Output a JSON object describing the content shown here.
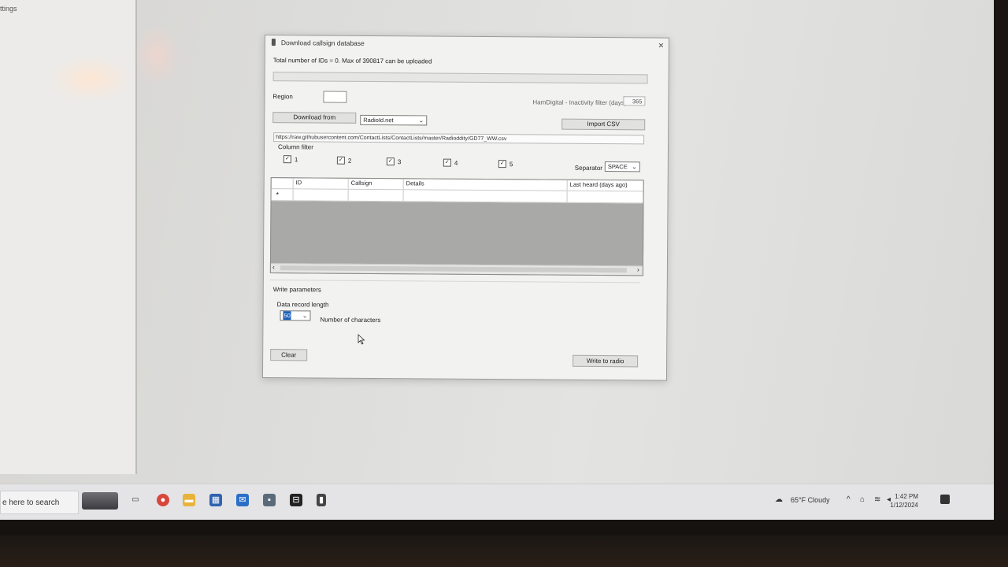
{
  "background_window": {
    "partial_text": "ttings"
  },
  "dialog": {
    "title": "Download callsign database",
    "close_glyph": "×",
    "total_text": "Total number of IDs = 0. Max of 390817 can be uploaded",
    "progress_fraction": 0,
    "region_label": "Region",
    "region_value": "",
    "inactivity_label": "HamDigital - Inactivity filter (days)",
    "inactivity_value": "365",
    "download_from_label": "Download from",
    "source_selected": "RadioId.net",
    "import_csv_label": "Import CSV",
    "url": "https://raw.githubusercontent.com/ContactLists/ContactLists/master/Radioddity/GD77_WW.csv",
    "column_filter_label": "Column filter",
    "column_checkboxes": [
      {
        "label": "1",
        "checked": true
      },
      {
        "label": "2",
        "checked": true
      },
      {
        "label": "3",
        "checked": true
      },
      {
        "label": "4",
        "checked": true
      },
      {
        "label": "5",
        "checked": true
      }
    ],
    "separator_label": "Separator",
    "separator_value": "SPACE",
    "grid": {
      "columns": [
        "ID",
        "Callsign",
        "Details",
        "Last heard (days ago)"
      ],
      "new_row_marker": "*"
    },
    "write_parameters_label": "Write parameters",
    "data_record_length_label": "Data record length",
    "data_record_length_value": "50",
    "number_of_characters_label": "Number of characters",
    "clear_label": "Clear",
    "write_to_radio_label": "Write to radio"
  },
  "taskbar": {
    "search_placeholder": "e here to search",
    "weather": "65°F  Cloudy",
    "time": "1:42 PM",
    "date": "1/12/2024"
  },
  "colors": {
    "dialog_bg": "#f2f2f1",
    "grid_empty": "#a9a9a8",
    "selection": "#1c5fb8"
  }
}
